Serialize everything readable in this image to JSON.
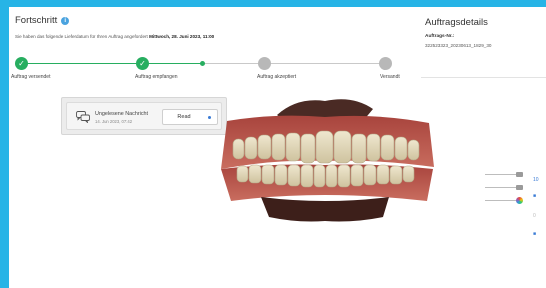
{
  "progress": {
    "title": "Fortschritt",
    "delivery_text": "Sie haben das folgende Lieferdatum für Ihren Auftrag angefordert",
    "delivery_date": "Mittwoch, 28. Juni 2023, 11:00",
    "steps": [
      {
        "label": "Auftrag versendet",
        "state": "done"
      },
      {
        "label": "Auftrag empfangen",
        "state": "done"
      },
      {
        "label": "Auftrag akzeptiert",
        "state": "pending"
      },
      {
        "label": "Versandt",
        "state": "pending"
      }
    ],
    "colors": {
      "done": "#27ae60",
      "pending": "#b8b8b8",
      "frame": "#27b4e6"
    }
  },
  "notification": {
    "title": "Ungelesene Nachricht",
    "date": "14. Jun 2023, 07:42",
    "read_label": "Read"
  },
  "details": {
    "title": "Auftragsdetails",
    "order_label": "Auftrags-Nr.:",
    "order_value": "322523323_20230613_1829_30"
  },
  "viewer": {
    "tool_icons": [
      "tooth-view-icon",
      "jaw-view-icon",
      "color-wheel-icon"
    ],
    "right_icons": [
      "measure-icon",
      "camera-icon",
      "settings-icon",
      "chat-icon"
    ],
    "right_snippets": [
      "10",
      "",
      "0",
      ""
    ]
  }
}
